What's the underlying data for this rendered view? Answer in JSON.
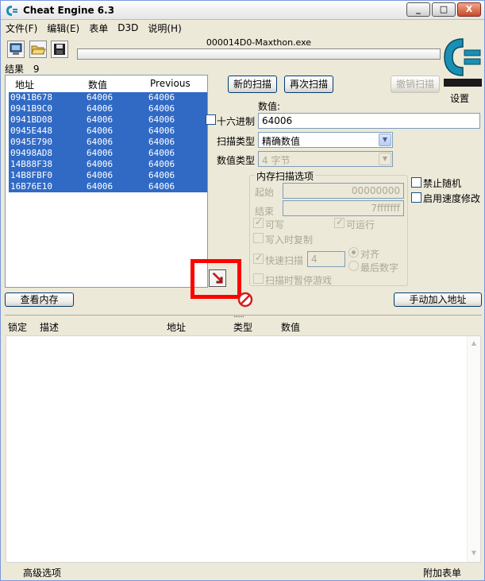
{
  "window": {
    "title": "Cheat Engine 6.3",
    "btn_min": "_",
    "btn_max": "□",
    "btn_close": "X"
  },
  "menu": [
    "文件(F)",
    "编辑(E)",
    "表单",
    "D3D",
    "说明(H)"
  ],
  "process": {
    "name": "000014D0-Maxthon.exe"
  },
  "logo_text": "Cheat Engine",
  "settings_label": "设置",
  "results": {
    "label": "结果",
    "count": "9"
  },
  "results_table": {
    "headers": {
      "address": "地址",
      "value": "数值",
      "previous": "Previous"
    },
    "rows": [
      {
        "address": "0941B678",
        "value": "64006",
        "previous": "64006"
      },
      {
        "address": "0941B9C0",
        "value": "64006",
        "previous": "64006"
      },
      {
        "address": "0941BD08",
        "value": "64006",
        "previous": "64006"
      },
      {
        "address": "0945E448",
        "value": "64006",
        "previous": "64006"
      },
      {
        "address": "0945E790",
        "value": "64006",
        "previous": "64006"
      },
      {
        "address": "09498AD8",
        "value": "64006",
        "previous": "64006"
      },
      {
        "address": "14B88F38",
        "value": "64006",
        "previous": "64006"
      },
      {
        "address": "14B8FBF0",
        "value": "64006",
        "previous": "64006"
      },
      {
        "address": "16B76E10",
        "value": "64006",
        "previous": "64006"
      }
    ]
  },
  "scan": {
    "new_scan": "新的扫描",
    "next_scan": "再次扫描",
    "undo_scan": "撤销扫描",
    "value_label": "数值:",
    "hex_label": "十六进制",
    "value": "64006",
    "scan_type_label": "扫描类型",
    "scan_type": "精确数值",
    "value_type_label": "数值类型",
    "value_type": "4 字节"
  },
  "memory_options": {
    "title": "内存扫描选项",
    "start_label": "起始",
    "start_value": "00000000",
    "stop_label": "结束",
    "stop_value": "7fffffff",
    "writable": "可写",
    "executable": "可运行",
    "copy_on_write": "写入时复制",
    "fast_scan": "快速扫描",
    "fast_scan_value": "4",
    "alignment": "对齐",
    "last_digits": "最后数字",
    "pause_game": "扫描时暂停游戏"
  },
  "side_options": {
    "unrandomizer": "禁止随机",
    "speedhack": "启用速度修改"
  },
  "view_memory": "查看内存",
  "add_address": "手动加入地址",
  "splitter_text": "......",
  "address_list": {
    "headers": {
      "active": "锁定",
      "description": "描述",
      "address": "地址",
      "type": "类型",
      "value": "数值"
    }
  },
  "footer": {
    "advanced": "高级选项",
    "table_extras": "附加表单"
  },
  "colors": {
    "selection": "#316ac5",
    "highlight": "#ff0000",
    "logo": "#1a8fb5"
  }
}
